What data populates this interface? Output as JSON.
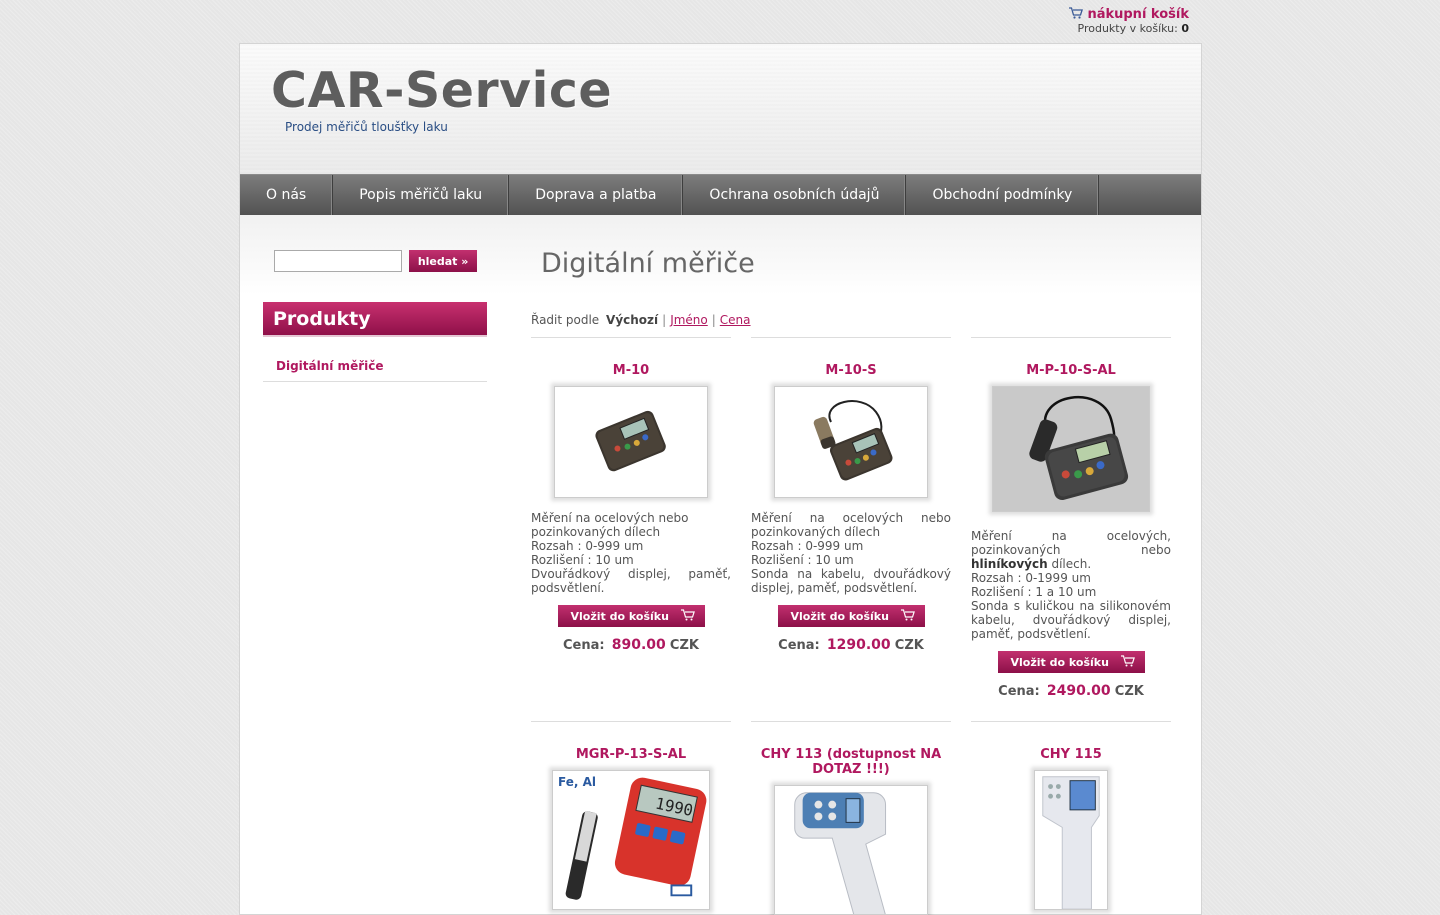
{
  "cart": {
    "title": "nákupní košík",
    "label": "Produkty v košíku:",
    "count": "0"
  },
  "header": {
    "logo": "CAR-Service",
    "slogan": "Prodej měřičů tloušťky laku"
  },
  "nav": [
    "O nás",
    "Popis měřičů laku",
    "Doprava a platba",
    "Ochrana osobních údajů",
    "Obchodní podmínky"
  ],
  "search": {
    "value": "",
    "button": "hledat »"
  },
  "sidebar": {
    "title": "Produkty",
    "items": [
      "Digitální měřiče"
    ]
  },
  "category": {
    "title": "Digitální měřiče",
    "sort_label": "Řadit podle",
    "sort_active": "Výchozí",
    "sort_links": [
      "Jméno",
      "Cena"
    ]
  },
  "products": [
    {
      "name": "M-10",
      "desc": [
        "Měření na ocelových nebo",
        "pozinkovaných dílech",
        "Rozsah : 0-999 um",
        "Rozlišení : 10 um",
        "Dvouřádkový displej, paměť,",
        "podsvětlení."
      ],
      "button": "Vložit do košíku",
      "price_label": "Cena:",
      "price": "890.00",
      "currency": "CZK"
    },
    {
      "name": "M-10-S",
      "desc": [
        "Měření na ocelových nebo",
        "pozinkovaných dílech",
        "Rozsah : 0-999 um",
        "Rozlišení : 10 um",
        "Sonda na kabelu, dvouřádkový",
        "displej, paměť, podsvětlení."
      ],
      "button": "Vložit do košíku",
      "price_label": "Cena:",
      "price": "1290.00",
      "currency": "CZK"
    },
    {
      "name": "M-P-10-S-AL",
      "desc_a": "Měření na ocelových, pozinkovaných nebo",
      "desc_bold": "hliníkových",
      "desc_b": "dílech.",
      "desc": [
        "Rozsah : 0-1999 um",
        "Rozlišení : 1 a 10 um",
        "Sonda s kuličkou na silikonovém kabelu, dvouřádkový displej, paměť, podsvětlení."
      ],
      "button": "Vložit do košíku",
      "price_label": "Cena:",
      "price": "2490.00",
      "currency": "CZK"
    },
    {
      "name": "MGR-P-13-S-AL",
      "image_text": "Fe, Al",
      "display": "1990"
    },
    {
      "name": "CHY 113 (dostupnost NA DOTAZ !!!)"
    },
    {
      "name": "CHY 115"
    }
  ],
  "colors": {
    "accent": "#b0185f",
    "nav": "#5e5e5e",
    "slogan": "#2a4e84"
  }
}
